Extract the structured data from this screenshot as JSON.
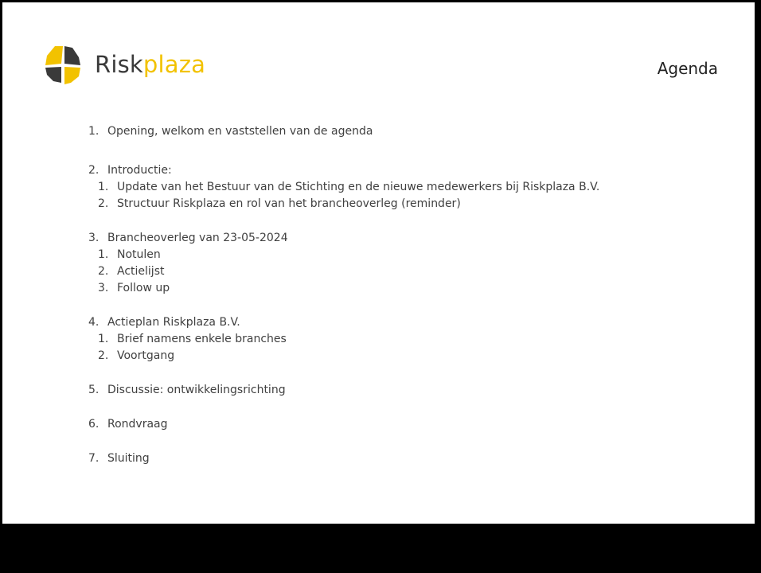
{
  "header": {
    "logo": {
      "part1": "Risk",
      "part2": "plaza"
    },
    "title": "Agenda"
  },
  "agenda": [
    {
      "num": "1.",
      "text": "Opening, welkom en vaststellen van de agenda",
      "subs": []
    },
    {
      "num": "2.",
      "text": "Introductie:",
      "subs": [
        {
          "num": "1.",
          "text": "Update van het Bestuur van de Stichting en de nieuwe medewerkers bij Riskplaza B.V."
        },
        {
          "num": "2.",
          "text": "Structuur Riskplaza en rol van het brancheoverleg (reminder)"
        }
      ]
    },
    {
      "num": "3.",
      "text": "Brancheoverleg van 23-05-2024",
      "subs": [
        {
          "num": "1.",
          "text": "Notulen"
        },
        {
          "num": "2.",
          "text": "Actielijst"
        },
        {
          "num": "3.",
          "text": "Follow up"
        }
      ]
    },
    {
      "num": "4.",
      "text": "Actieplan Riskplaza B.V.",
      "subs": [
        {
          "num": "1.",
          "text": "Brief namens enkele branches"
        },
        {
          "num": "2.",
          "text": "Voortgang"
        }
      ]
    },
    {
      "num": "5.",
      "text": "Discussie: ontwikkelingsrichting",
      "subs": []
    },
    {
      "num": "6.",
      "text": "Rondvraag",
      "subs": []
    },
    {
      "num": "7.",
      "text": "Sluiting",
      "subs": []
    }
  ],
  "colors": {
    "brand_yellow": "#f2c200",
    "brand_dark": "#3a3a3a"
  }
}
